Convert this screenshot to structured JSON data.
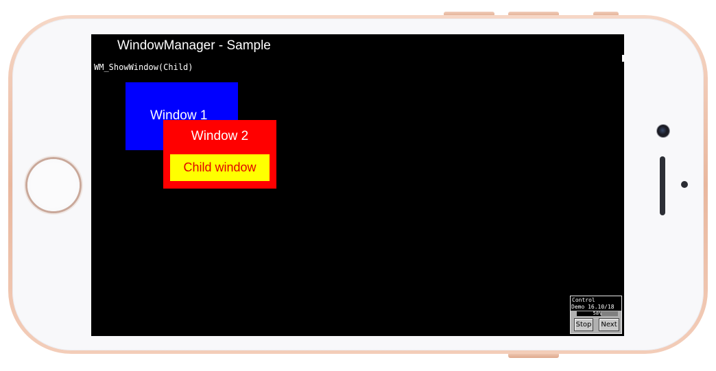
{
  "app": {
    "title": "WindowManager - Sample",
    "subtitle": "WM_ShowWindow(Child)"
  },
  "windows": {
    "window1": {
      "label": "Window 1",
      "color": "#0000ff"
    },
    "window2": {
      "label": "Window 2",
      "color": "#ff0000"
    },
    "child": {
      "label": "Child window",
      "color": "#ffff00",
      "text_color": "#e00000"
    }
  },
  "control": {
    "title": "Control",
    "info": "Demo 16.10/18",
    "progress_percent": 58,
    "progress_label": "58%",
    "stop_label": "Stop",
    "next_label": "Next"
  },
  "device": {
    "frame_color": "#e9b79e",
    "screen_color": "#000000"
  }
}
